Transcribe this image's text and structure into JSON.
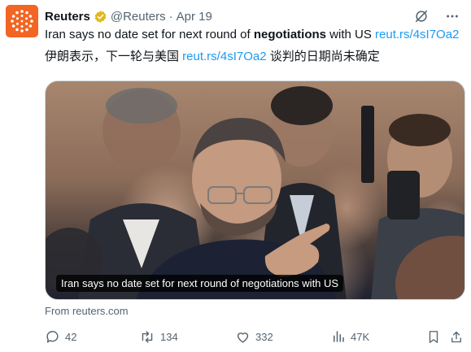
{
  "tweet": {
    "author": "Reuters",
    "handle": "@Reuters",
    "separator": "·",
    "date": "Apr 19",
    "text_en_pre": "Iran says no date set for next round of ",
    "text_en_bold": "negotiations",
    "text_en_post": " with US ",
    "link": "reut.rs/4sI7Oa2",
    "text_zh_pre": "伊朗表示，下一轮与美国 ",
    "text_zh_post": " 谈判的日期尚未确定"
  },
  "media": {
    "caption": "Iran says no date set for next round of negotiations with US"
  },
  "source": "From reuters.com",
  "stats": {
    "replies": "42",
    "reposts": "134",
    "likes": "332",
    "views": "47K"
  },
  "colors": {
    "brand": "#f26522",
    "link": "#1d9bf0",
    "muted": "#536471",
    "verified": "#e2b719"
  },
  "icons": [
    "reuters-logo-icon",
    "verified-badge-icon",
    "grok-icon",
    "more-icon",
    "reply-icon",
    "repost-icon",
    "like-icon",
    "views-icon",
    "bookmark-icon",
    "share-icon"
  ]
}
